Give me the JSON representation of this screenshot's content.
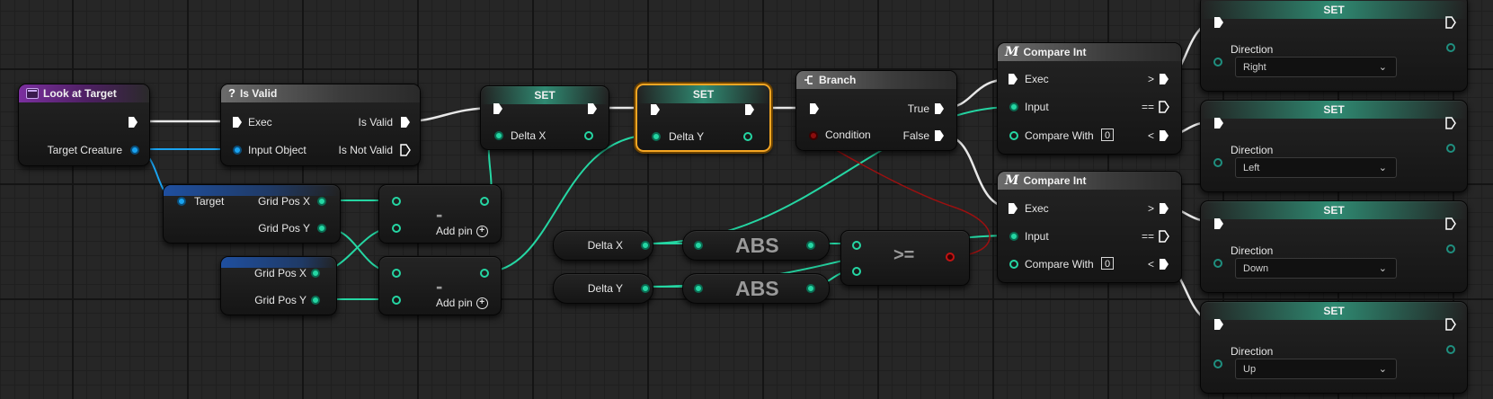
{
  "colors": {
    "exec_pin": "#ffffff",
    "int_pin": "#25d6a3",
    "object_pin": "#1aa3f0",
    "bool_pin": "#c31313",
    "selection": "#f5a623",
    "function_header": "#7b2f9f",
    "set_header": "#2f8a72"
  },
  "nodes": {
    "look_at_target": {
      "title": "Look at Target",
      "icon": "function-icon",
      "pins": {
        "target_creature": "Target Creature"
      }
    },
    "is_valid": {
      "title": "Is Valid",
      "icon": "question-icon",
      "pins": {
        "exec": "Exec",
        "input_object": "Input Object",
        "is_valid": "Is Valid",
        "is_not_valid": "Is Not Valid"
      }
    },
    "target_break": {
      "pins": {
        "target": "Target",
        "grid_pos_x": "Grid Pos X",
        "grid_pos_y": "Grid Pos Y"
      }
    },
    "self_break": {
      "pins": {
        "grid_pos_x": "Grid Pos X",
        "grid_pos_y": "Grid Pos Y"
      }
    },
    "subtract_1": {
      "operator": "-",
      "add_pin": "Add pin"
    },
    "subtract_2": {
      "operator": "-",
      "add_pin": "Add pin"
    },
    "set_delta_x": {
      "title": "SET",
      "pin": "Delta X"
    },
    "set_delta_y": {
      "title": "SET",
      "pin": "Delta Y",
      "selected": true
    },
    "get_delta_x": {
      "label": "Delta X"
    },
    "get_delta_y": {
      "label": "Delta Y"
    },
    "abs_1": {
      "label": "ABS"
    },
    "abs_2": {
      "label": "ABS"
    },
    "gte": {
      "label": ">="
    },
    "branch": {
      "title": "Branch",
      "icon": "branch-icon",
      "pins": {
        "condition": "Condition",
        "true": "True",
        "false": "False"
      }
    },
    "compare_int_1": {
      "title": "Compare Int",
      "icon": "macro-icon",
      "pins": {
        "exec": "Exec",
        "input": "Input",
        "compare_with": "Compare With",
        "compare_value": "0",
        "gt": ">",
        "eq": "==",
        "lt": "<"
      }
    },
    "compare_int_2": {
      "title": "Compare Int",
      "icon": "macro-icon",
      "pins": {
        "exec": "Exec",
        "input": "Input",
        "compare_with": "Compare With",
        "compare_value": "0",
        "gt": ">",
        "eq": "==",
        "lt": "<"
      }
    },
    "set_dir_1": {
      "title": "SET",
      "field": "Direction",
      "value": "Right"
    },
    "set_dir_2": {
      "title": "SET",
      "field": "Direction",
      "value": "Left"
    },
    "set_dir_3": {
      "title": "SET",
      "field": "Direction",
      "value": "Down"
    },
    "set_dir_4": {
      "title": "SET",
      "field": "Direction",
      "value": "Up"
    }
  }
}
